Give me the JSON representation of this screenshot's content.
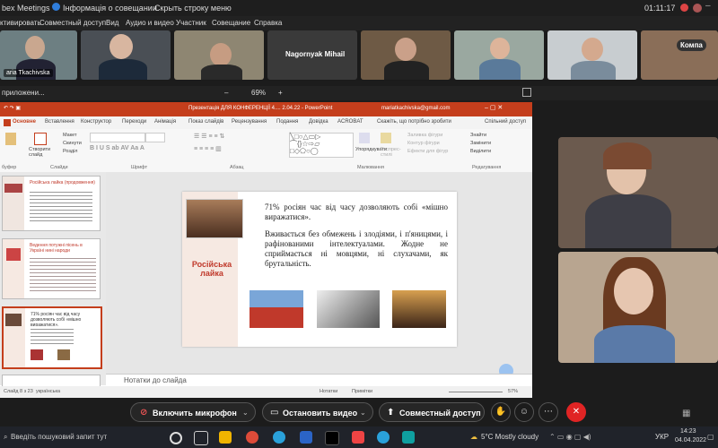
{
  "topbar": {
    "app": "bex Meetings",
    "meeting_info": "Інформація о совещании",
    "hide_menu": "Скрыть строку меню",
    "time": "01:11:17"
  },
  "menu": [
    "ктивировать",
    "Совместный доступ",
    "Вид",
    "Аудио и видео",
    "Участник",
    "Совещание",
    "Справка"
  ],
  "participants": {
    "first_name": "aria Tkachivska",
    "named": "Nagornyak Mihail",
    "more": "Компа"
  },
  "sharebar": {
    "label": "приложени...",
    "zoom": "69%"
  },
  "ppt": {
    "title": "Презентація ДЛЯ КОНФЕРЕНЦІЇ 4.... 2.04.22 - PowerPoint",
    "user": "mariatkachivska@gmail.com",
    "search": "Скажіть, що потрібно зробити",
    "share": "Спільний доступ",
    "tabs": [
      "Основне",
      "Вставлення",
      "Конструктор",
      "Переходи",
      "Анімація",
      "Показ слайдів",
      "Рецензування",
      "Подання",
      "Довідка",
      "ACROBAT"
    ],
    "ribbon": {
      "slides_group": "Слайди",
      "font_group": "Шрифт",
      "paragraph_group": "Абзац",
      "drawing_group": "Малювання",
      "editing_group": "Редагування",
      "clipboard_group": "буфер",
      "new_slide": "Створити слайд",
      "layout": "Макет",
      "reset": "Скинути",
      "section": "Розділ",
      "arrange": "Упорядкувати",
      "styles": "Експрес-стилі",
      "fill": "Заливка фігури",
      "outline": "Контур фігури",
      "effects": "Ефекти для фігур",
      "find": "Знайти",
      "replace": "Замінити",
      "select": "Виділити"
    },
    "slide": {
      "side_label": "Російська лайка",
      "para1": "71% росіян час від часу дозволяють собі «мішно виражатися».",
      "para2": "Вживається без обмежень і злодіями, і п'яницями, і рафінованими інтелектуалами. Жодне не сприймається ні мовцями, ні слухачами, як брутальність."
    },
    "thumbs": {
      "t1_title": "Російська лайка (продовження)",
      "t2_title": "Ведення потужні пісень в Україні нині народи",
      "t3_text": "71% росіян час від часу дозволяють собі «мішно виражатися»."
    },
    "notes": "Нотатки до слайда",
    "status": {
      "slide": "Слайд 8 з 23",
      "lang": "українська",
      "notes_btn": "Нотатки",
      "comments_btn": "Примітки",
      "zoom": "57%"
    }
  },
  "callbar": {
    "mic": "Включить микрофон",
    "video": "Остановить видео",
    "share": "Совместный доступ"
  },
  "taskbar": {
    "search": "Введіть пошуковий запит тут",
    "weather": "5°C  Mostly cloudy",
    "lang": "УКР",
    "time": "14:23",
    "date": "04.04.2022"
  },
  "colors": {
    "accent": "#c43e1c",
    "end_call": "#e02424",
    "slide_red": "#c0392b"
  }
}
